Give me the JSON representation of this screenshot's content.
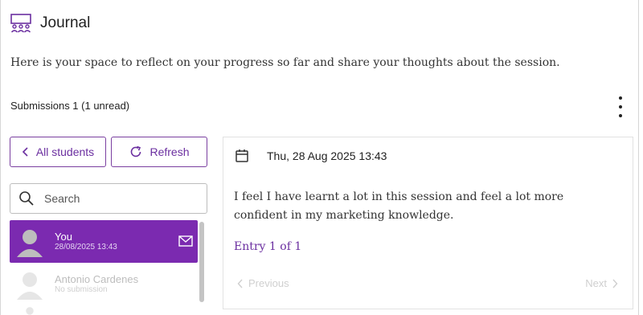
{
  "header": {
    "title": "Journal",
    "icon": "group-icon"
  },
  "intro": "Here is your space to reflect on your progress so far and share your thoughts about the session.",
  "submissions_label": "Submissions 1 (1 unread)",
  "buttons": {
    "all_students": "All students",
    "refresh": "Refresh"
  },
  "search": {
    "placeholder": "Search",
    "value": ""
  },
  "students": [
    {
      "name": "You",
      "sub": "28/08/2025 13:43",
      "active": true
    },
    {
      "name": "Antonio Cardenes",
      "sub": "No submission",
      "active": false
    }
  ],
  "entry": {
    "date": "Thu, 28 Aug 2025 13:43",
    "text": "I feel I have learnt a lot in this session and feel a lot more confident in my marketing knowledge.",
    "count": "Entry 1 of 1",
    "previous": "Previous",
    "next": "Next"
  },
  "colors": {
    "accent": "#7b2ab0",
    "text": "#222222"
  }
}
